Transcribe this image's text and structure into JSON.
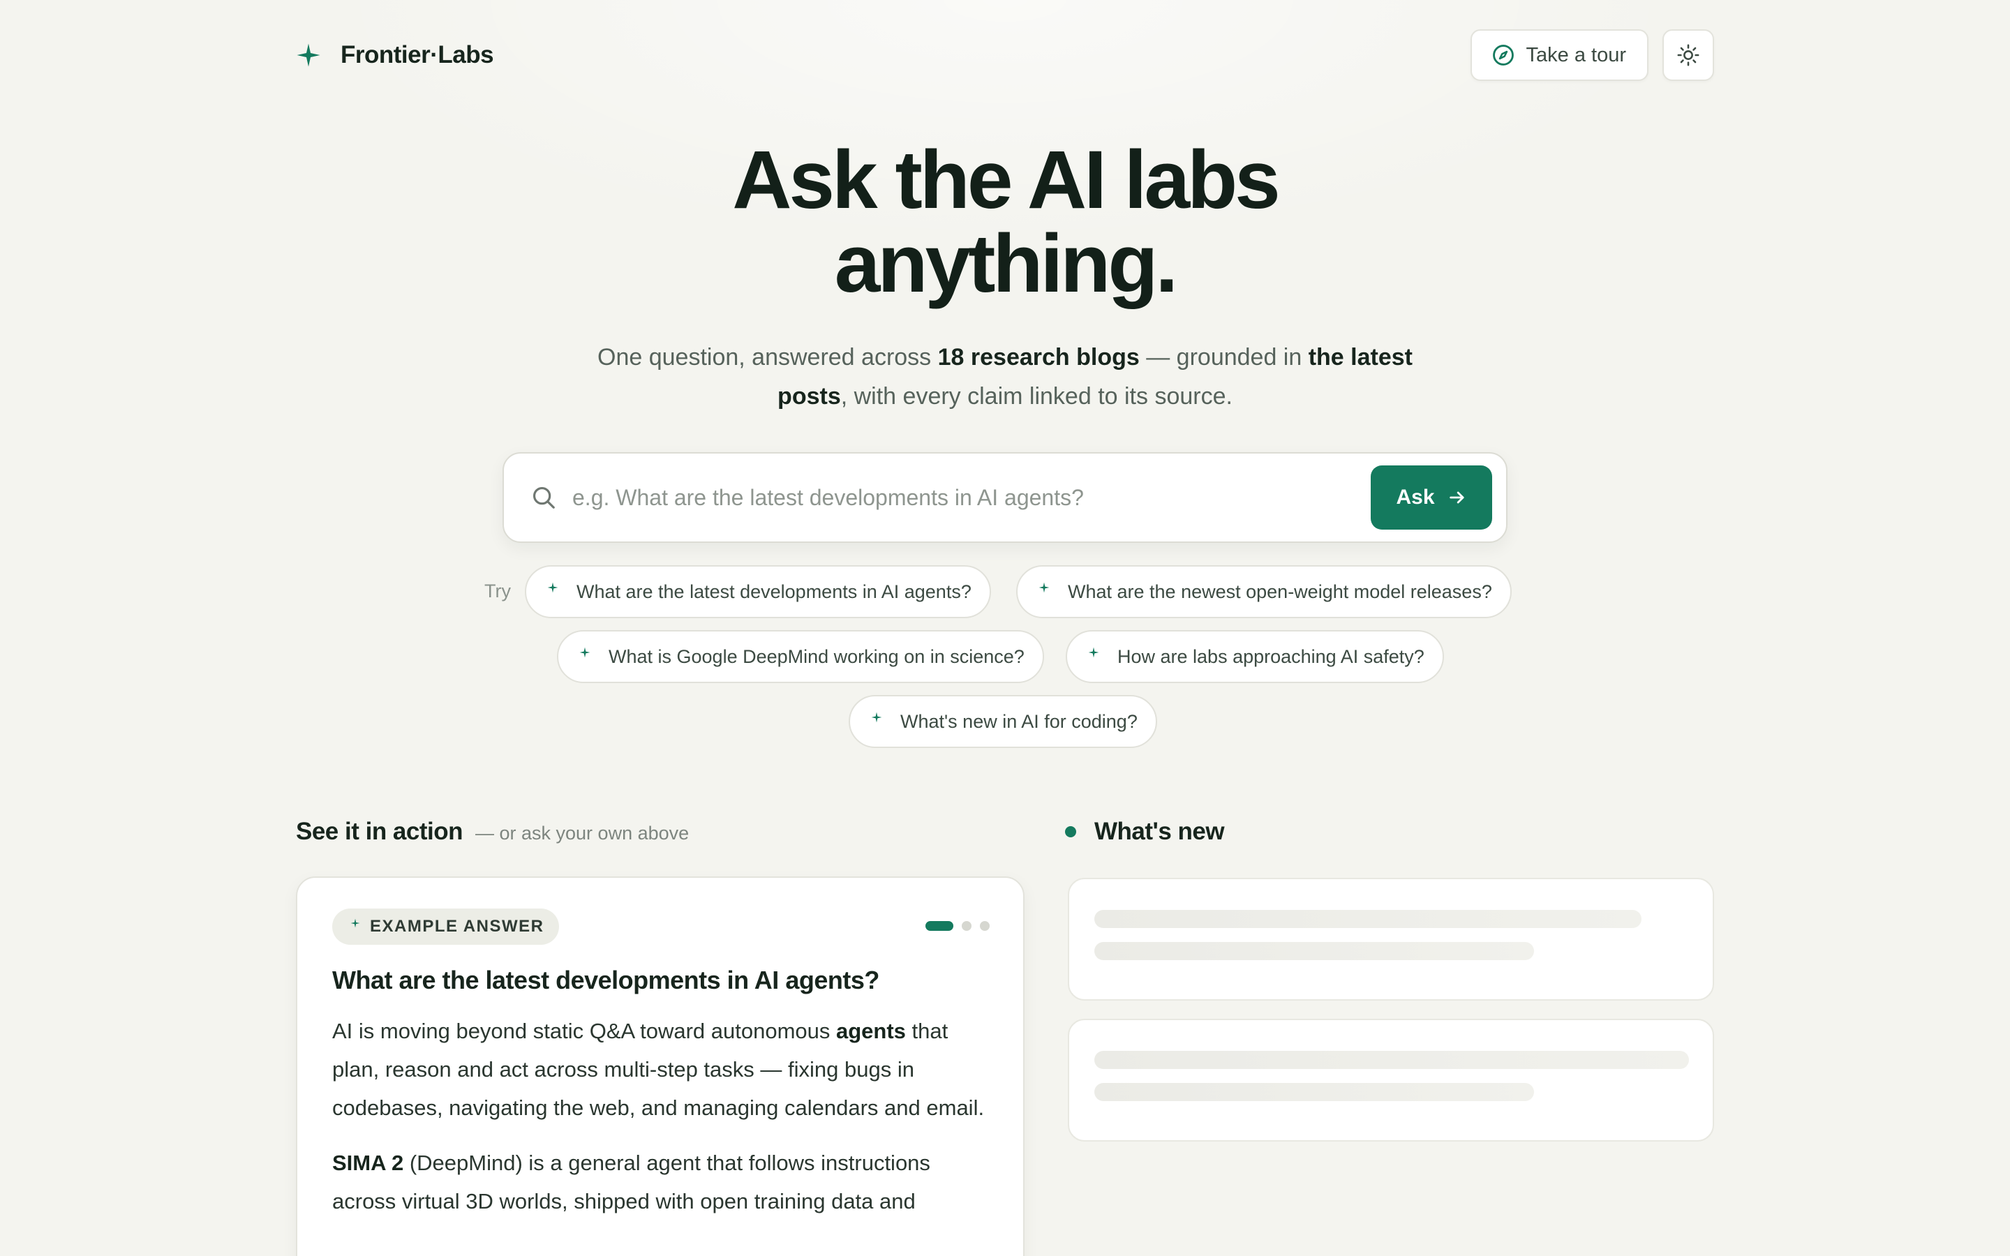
{
  "brand": {
    "name": "Frontier·Labs",
    "icon": "sparkle-icon",
    "accent": "#147a5e"
  },
  "header": {
    "tour_label": "Take a tour",
    "tour_icon": "compass-icon",
    "theme_icon": "sun-icon"
  },
  "hero": {
    "title_line1": "Ask the AI labs",
    "title_line2": "anything.",
    "sub_1": "One question, answered across ",
    "sub_2": "18 research blogs",
    "sub_3": " — grounded in ",
    "sub_4": "the latest posts",
    "sub_5": ", with every claim linked to its source."
  },
  "search": {
    "placeholder": "e.g. What are the latest developments in AI agents?",
    "value": "",
    "ask_label": "Ask"
  },
  "suggestions": {
    "try_label": "Try",
    "items": [
      "What are the latest developments in AI agents?",
      "What are the newest open-weight model releases?",
      "What is Google DeepMind working on in science?",
      "How are labs approaching AI safety?",
      "What's new in AI for coding?"
    ]
  },
  "action": {
    "title": "See it in action",
    "note": "— or ask your own above",
    "badge": "EXAMPLE ANSWER",
    "question": "What are the latest developments in AI agents?",
    "p1_a": "AI is moving beyond static Q&A toward autonomous ",
    "p1_b": "agents",
    "p1_c": " that plan, reason and act across multi-step tasks — fixing bugs in codebases, navigating the web, and managing calendars and email.",
    "p2_a": "SIMA 2",
    "p2_b": " (DeepMind) is a general agent that follows instructions across virtual 3D worlds, shipped with open training data and"
  },
  "news": {
    "title": "What's new"
  }
}
